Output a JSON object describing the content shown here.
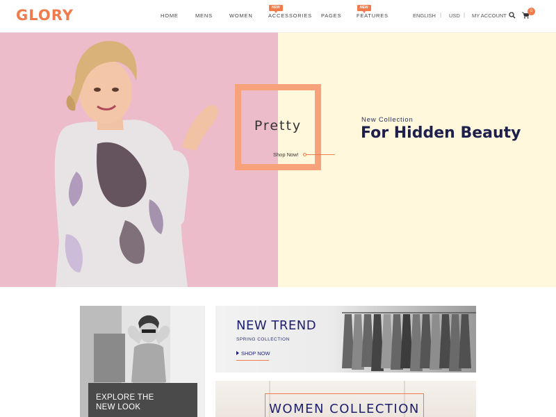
{
  "brand": {
    "logo": "GLORY",
    "accent_color": "#f07c4c"
  },
  "nav": {
    "items": [
      {
        "label": "HOME"
      },
      {
        "label": "MENS"
      },
      {
        "label": "WOMEN"
      },
      {
        "label": "ACCESSORIES",
        "badge": "NEW"
      },
      {
        "label": "PAGES"
      },
      {
        "label": "FEATURES",
        "badge": "NEW"
      }
    ]
  },
  "utility": {
    "language": "ENGLISH",
    "currency": "USD",
    "account": "MY ACCOUNT",
    "search_icon": "search-icon",
    "cart_icon": "cart-icon",
    "cart_count": "0"
  },
  "hero": {
    "frame_word": "Pretty",
    "shop_now": "Shop Now!",
    "eyebrow": "New Collection",
    "title": "For Hidden Beauty",
    "left_bg": "#ecbccb",
    "right_bg": "#fff8dd"
  },
  "banners": {
    "explore": {
      "text_line1": "EXPLORE THE",
      "text_line2": "NEW LOOK"
    },
    "trend": {
      "title": "NEW TREND",
      "subtitle": "SPRING COLLECTION",
      "cta": "SHOP NOW"
    },
    "women": {
      "title": "WOMEN COLLECTION"
    }
  }
}
